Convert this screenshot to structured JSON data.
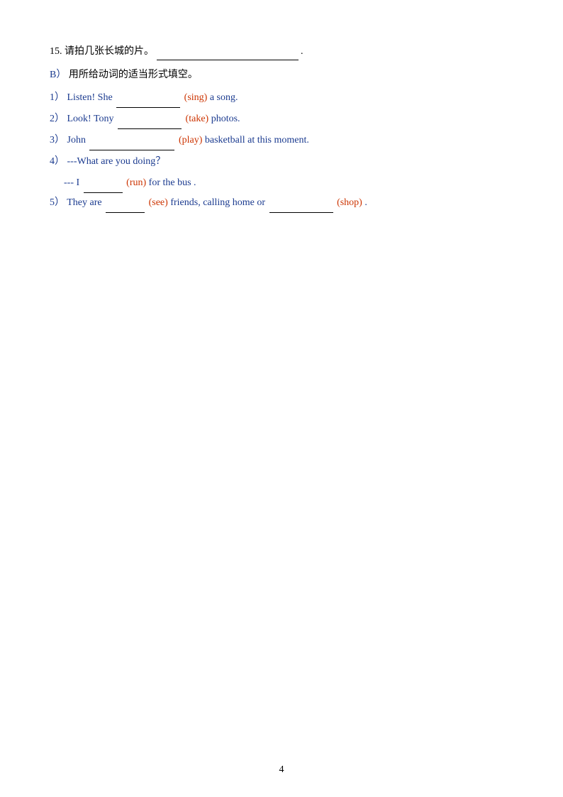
{
  "page": {
    "number": "4"
  },
  "question15": {
    "label": "15.",
    "text_cn": "请拍几张长城的片。",
    "blank_line": ""
  },
  "sectionB": {
    "label": "B）",
    "instruction": "用所给动词的适当形式填空。"
  },
  "items": [
    {
      "number": "1）",
      "before": "Listen! She",
      "blank": "",
      "hint": "(sing)",
      "after": "a song."
    },
    {
      "number": "2）",
      "before": "Look! Tony",
      "blank": "",
      "hint": "(take)",
      "after": "photos."
    },
    {
      "number": "3）",
      "before": "John",
      "blank": "",
      "hint": "(play)",
      "after": "basketball at this moment."
    },
    {
      "number": "4）",
      "before": "---What are you doing？",
      "sub_before": "--- I",
      "sub_blank": "",
      "sub_hint": "(run)",
      "sub_after": "for the bus ."
    },
    {
      "number": "5）",
      "before": "They are",
      "blank1": "",
      "hint1": "(see)",
      "middle": "friends, calling home or",
      "blank2": "",
      "hint2": "(shop)",
      "after": "."
    }
  ]
}
